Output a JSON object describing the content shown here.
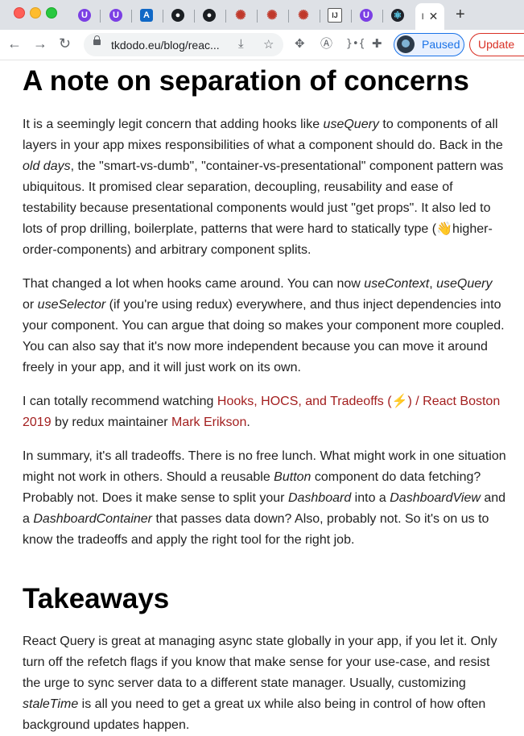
{
  "browser": {
    "tabs": [
      {
        "icon": "u-icon",
        "glyph": "U"
      },
      {
        "icon": "u-icon",
        "glyph": "U"
      },
      {
        "icon": "azure-icon",
        "glyph": "A"
      },
      {
        "icon": "github-icon",
        "glyph": "●"
      },
      {
        "icon": "github-icon",
        "glyph": "●"
      },
      {
        "icon": "react-query-icon",
        "glyph": "✺"
      },
      {
        "icon": "react-query-icon",
        "glyph": "✺"
      },
      {
        "icon": "react-query-icon",
        "glyph": "✺"
      },
      {
        "icon": "editor-icon",
        "glyph": "IJ"
      },
      {
        "icon": "u-icon",
        "glyph": "U"
      },
      {
        "icon": "react-icon",
        "glyph": "⚛"
      }
    ],
    "active_tab": {
      "title": "I",
      "close": "✕"
    },
    "new_tab": "+",
    "url": "tkdodo.eu/blog/reac...",
    "profile_label": "Paused",
    "update_label": "Update"
  },
  "article": {
    "heading1": "A note on separation of concerns",
    "p1": {
      "t1": "It is a seemingly legit concern that adding hooks like ",
      "e1": "useQuery",
      "t2": " to components of all layers in your app mixes responsibilities of what a component should do. Back in the ",
      "e2": "old days",
      "t3": ", the \"smart-vs-dumb\", \"container-vs-presentational\" component pattern was ubiquitous. It promised clear separation, decoupling, reusability and ease of testability because presentational components would just \"get props\". It also led to lots of prop drilling, boilerplate, patterns that were hard to statically type (",
      "emoji": "👋",
      "t4": "higher-order-components) and arbitrary component splits."
    },
    "p2": {
      "t1": "That changed a lot when hooks came around. You can now ",
      "e1": "useContext",
      "t2": ", ",
      "e2": "useQuery",
      "t3": " or ",
      "e3": "useSelector",
      "t4": " (if you're using redux) everywhere, and thus inject dependencies into your component. You can argue that doing so makes your component more coupled. You can also say that it's now more independent because you can move it around freely in your app, and it will just work on its own."
    },
    "p3": {
      "t1": "I can totally recommend watching ",
      "link1": "Hooks, HOCS, and Tradeoffs (⚡) / React Boston 2019",
      "t2": " by redux maintainer ",
      "link2": "Mark Erikson",
      "t3": "."
    },
    "p4": {
      "t1": "In summary, it's all tradeoffs. There is no free lunch. What might work in one situation might not work in others. Should a reusable ",
      "e1": "Button",
      "t2": " component do data fetching? Probably not. Does it make sense to split your ",
      "e2": "Dashboard",
      "t3": " into a ",
      "e3": "DashboardView",
      "t4": " and a ",
      "e4": "DashboardContainer",
      "t5": " that passes data down? Also, probably not. So it's on us to know the tradeoffs and apply the right tool for the right job."
    },
    "heading2": "Takeaways",
    "p5": {
      "t1": "React Query is great at managing async state globally in your app, if you let it. Only turn off the refetch flags if you know that make sense for your use-case, and resist the urge to sync server data to a different state manager. Usually, customizing ",
      "e1": "staleTime",
      "t2": " is all you need to get a great ux while also being in control of how often background updates happen."
    }
  }
}
